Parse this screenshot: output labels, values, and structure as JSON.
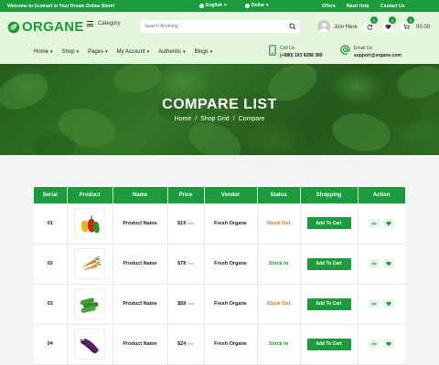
{
  "topbar": {
    "welcome": "Welcome to Ecomart in Your Dream Online Store!",
    "language": "English",
    "currency": "Dollar",
    "links": [
      "Offers",
      "Need Help",
      "Contact Us"
    ]
  },
  "header": {
    "logo_text": "ORGANE",
    "category_label": "Category",
    "search_placeholder": "Search Anything...",
    "join_label": "Join Here",
    "compare_count": "0",
    "wishlist_count": "0",
    "cart_count": "0",
    "cart_amount": "00.00",
    "nav": [
      "Home",
      "Shop",
      "Pages",
      "My Account",
      "Authentic",
      "Blogs"
    ],
    "call_label": "Call Us",
    "call_value": "(+880) 163 8288 389",
    "email_label": "Email Us",
    "email_value": "support@organe.com"
  },
  "banner": {
    "title": "COMPARE LIST",
    "breadcrumb": [
      "Home",
      "Shop Grid",
      "Compare"
    ]
  },
  "table": {
    "headers": [
      "Serial",
      "Product",
      "Name",
      "Price",
      "Vendor",
      "Status",
      "Shopping",
      "Action"
    ],
    "rows": [
      {
        "serial": "01",
        "image": "peppers",
        "name": "Product Name",
        "price": "$19",
        "unit": "/kilo",
        "vendor": "Fresh Organe",
        "status": "Stock Out",
        "button": "Add To Cart"
      },
      {
        "serial": "02",
        "image": "carrots",
        "name": "Product Name",
        "price": "$78",
        "unit": "/kilo",
        "vendor": "Fresh Organe",
        "status": "Stock In",
        "button": "Add To Cart"
      },
      {
        "serial": "03",
        "image": "cucumbers",
        "name": "Product Name",
        "price": "$68",
        "unit": "/kilo",
        "vendor": "Fresh Organe",
        "status": "Stock Out",
        "button": "Add To Cart"
      },
      {
        "serial": "04",
        "image": "eggplants",
        "name": "Product Name",
        "price": "$24",
        "unit": "/kilo",
        "vendor": "Fresh Organe",
        "status": "Stock In",
        "button": "Add To Cart"
      }
    ]
  },
  "colors": {
    "brand": "#1a9b3c",
    "stock_out": "#e0761a",
    "stock_in": "#1a9b3c",
    "header_bg": "#e4f7dc"
  }
}
